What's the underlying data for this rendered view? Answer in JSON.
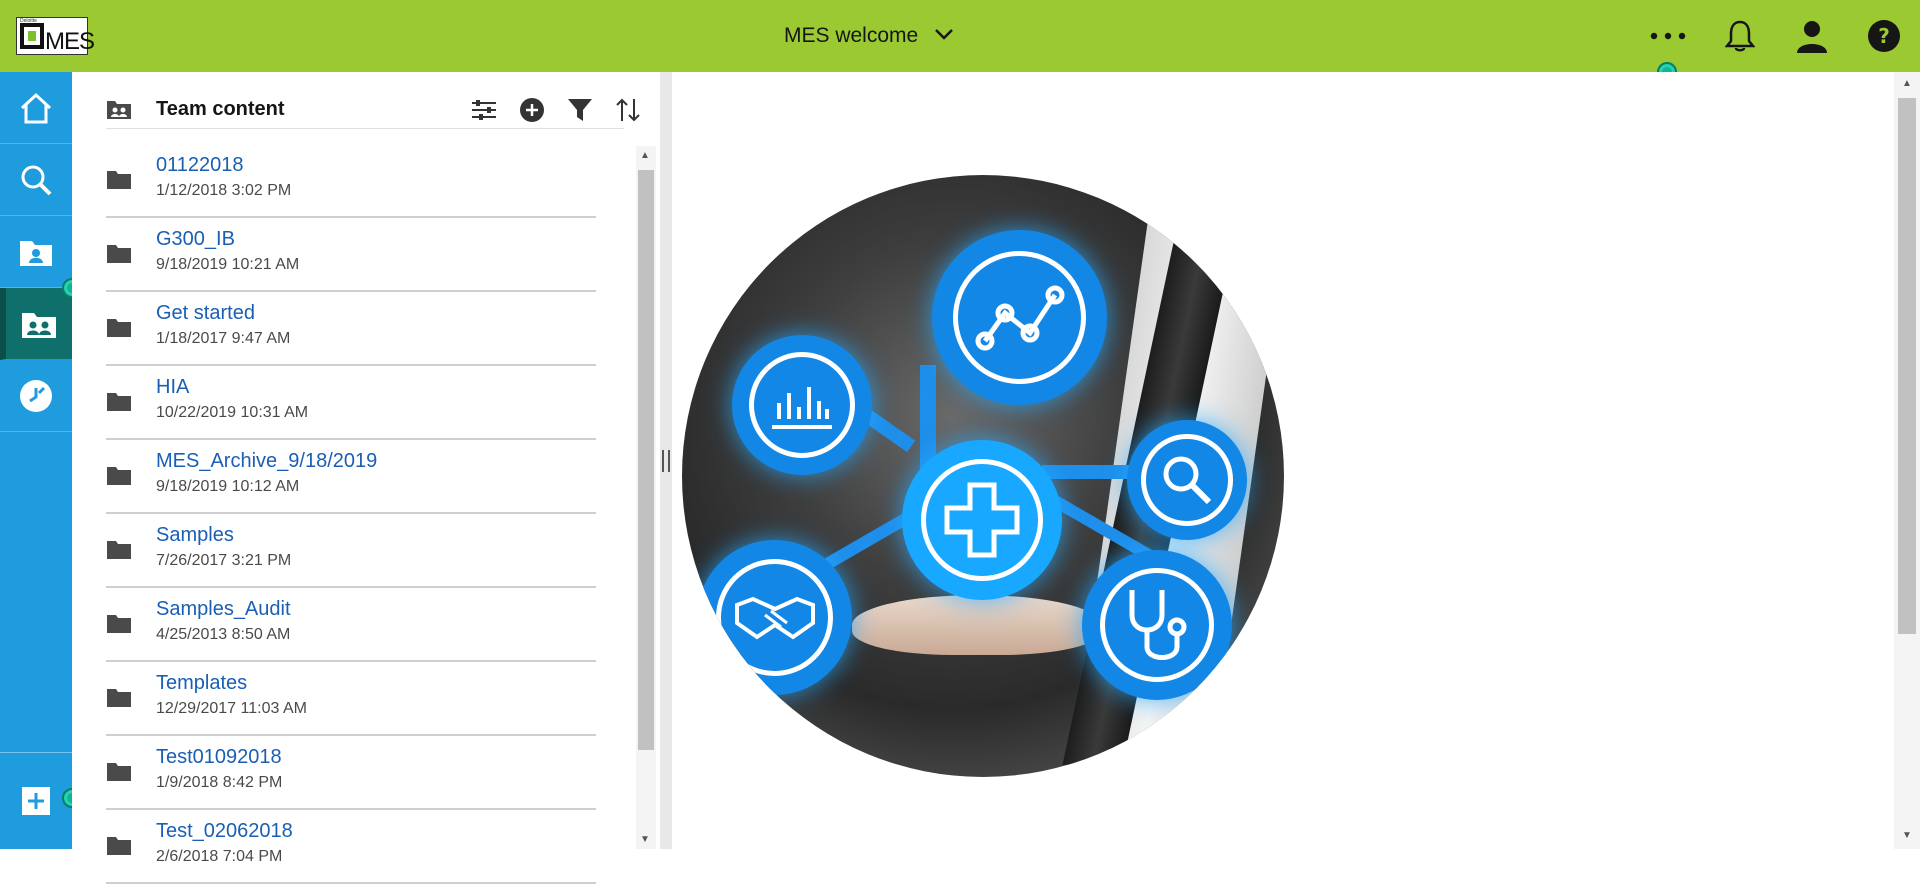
{
  "app": {
    "logo_text": "MES",
    "logo_small_text": "Deloitte",
    "title": "MES welcome"
  },
  "topbar_icons": [
    "more-icon",
    "bell-icon",
    "user-icon",
    "help-icon"
  ],
  "colors": {
    "topbar": "#9bc932",
    "nav": "#1f9cde",
    "nav_active": "#0f6f6a",
    "link": "#1a5fb4",
    "marker": "#14b397"
  },
  "leftnav": {
    "items": [
      "home-icon",
      "search-icon",
      "my-content-icon",
      "team-content-icon",
      "recent-icon"
    ],
    "active": "team-content-icon",
    "add": "add-icon"
  },
  "panel": {
    "title": "Team content",
    "header_icons": [
      "list-settings-icon",
      "add-circle-icon",
      "filter-icon",
      "sort-icon"
    ],
    "items": [
      {
        "name": "01122018",
        "date": "1/12/2018 3:02 PM"
      },
      {
        "name": "G300_IB",
        "date": "9/18/2019 10:21 AM"
      },
      {
        "name": "Get started",
        "date": "1/18/2017 9:47 AM"
      },
      {
        "name": "HIA",
        "date": "10/22/2019 10:31 AM"
      },
      {
        "name": "MES_Archive_9/18/2019",
        "date": "9/18/2019 10:12 AM"
      },
      {
        "name": "Samples",
        "date": "7/26/2017 3:21 PM"
      },
      {
        "name": "Samples_Audit",
        "date": "4/25/2013 8:50 AM"
      },
      {
        "name": "Templates",
        "date": "12/29/2017 11:03 AM"
      },
      {
        "name": "Test01092018",
        "date": "1/9/2018 8:42 PM"
      },
      {
        "name": "Test_02062018",
        "date": "2/6/2018 7:04 PM"
      }
    ]
  }
}
